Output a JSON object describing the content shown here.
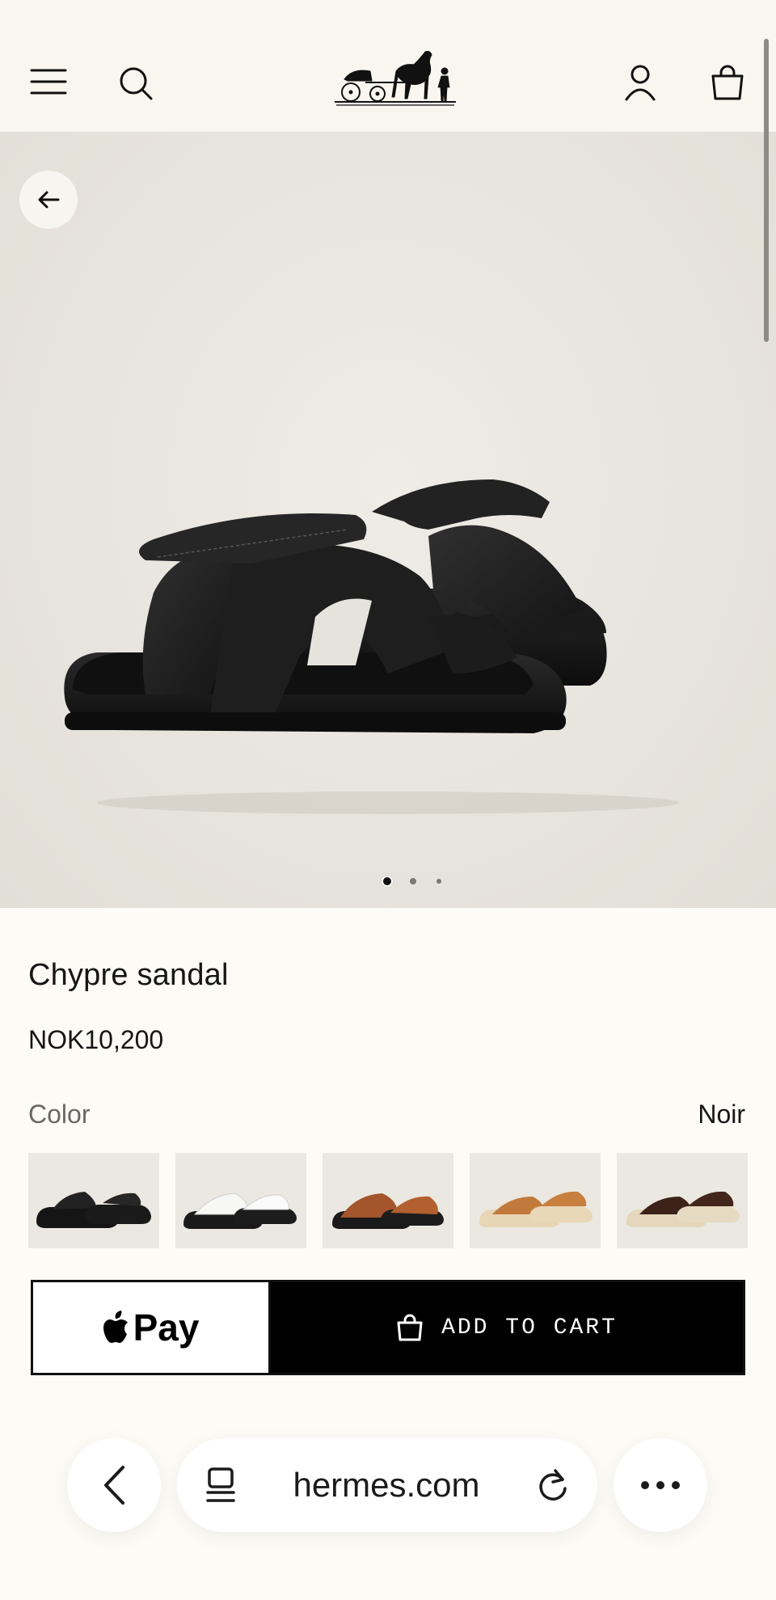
{
  "header": {
    "menu_icon": "hamburger-menu-icon",
    "search_icon": "search-icon",
    "logo_icon": "carriage-logo-icon",
    "account_icon": "user-account-icon",
    "cart_icon": "shopping-bag-icon"
  },
  "gallery": {
    "back_icon": "arrow-left-icon",
    "image_count": 3,
    "active_index": 0
  },
  "product": {
    "title": "Chypre sandal",
    "price": "NOK10,200",
    "color_label": "Color",
    "color_value": "Noir",
    "swatches": [
      {
        "name": "black",
        "color": "#1c1c1c"
      },
      {
        "name": "white",
        "color": "#f4f4f2"
      },
      {
        "name": "tan-suede",
        "color": "#a4552c"
      },
      {
        "name": "tan-shearling",
        "color": "#c27a3c"
      },
      {
        "name": "brown-shearling",
        "color": "#3c2218"
      }
    ]
  },
  "actions": {
    "apple_pay_label": "Pay",
    "add_to_cart_label": "ADD TO CART"
  },
  "browser": {
    "url": "hermes.com",
    "back_icon": "chevron-left-icon",
    "tabs_icon": "tabs-icon",
    "reload_icon": "reload-icon",
    "more_icon": "more-dots-icon"
  },
  "colors": {
    "background": "#fdfbf5",
    "header_bg": "#f8f6ef",
    "button_dark": "#000000"
  }
}
